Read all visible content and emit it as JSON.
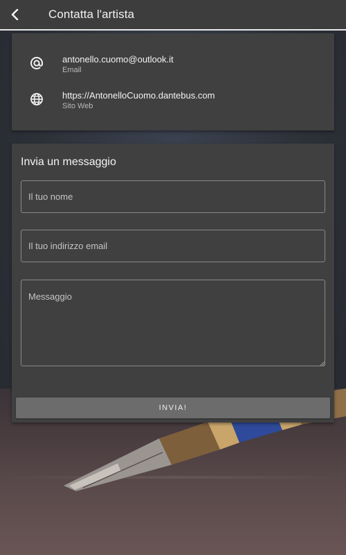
{
  "app_bar": {
    "title": "Contatta l'artista",
    "back_icon": "chevron-left-icon"
  },
  "contact_info": {
    "items": [
      {
        "icon": "at-sign-icon",
        "value": "antonello.cuomo@outlook.it",
        "label": "Email"
      },
      {
        "icon": "globe-icon",
        "value": "https://AntonelloCuomo.dantebus.com",
        "label": "Sito Web"
      }
    ]
  },
  "form": {
    "title": "Invia un messaggio",
    "name_placeholder": "Il tuo nome",
    "email_placeholder": "Il tuo indirizzo email",
    "message_placeholder": "Messaggio",
    "submit_label": "INVIA!"
  },
  "colors": {
    "app_bar_bg": "#3d3d3d",
    "card_bg": "#404040",
    "button_bg": "#6c6c6c",
    "text_primary": "#f3f3f3"
  }
}
